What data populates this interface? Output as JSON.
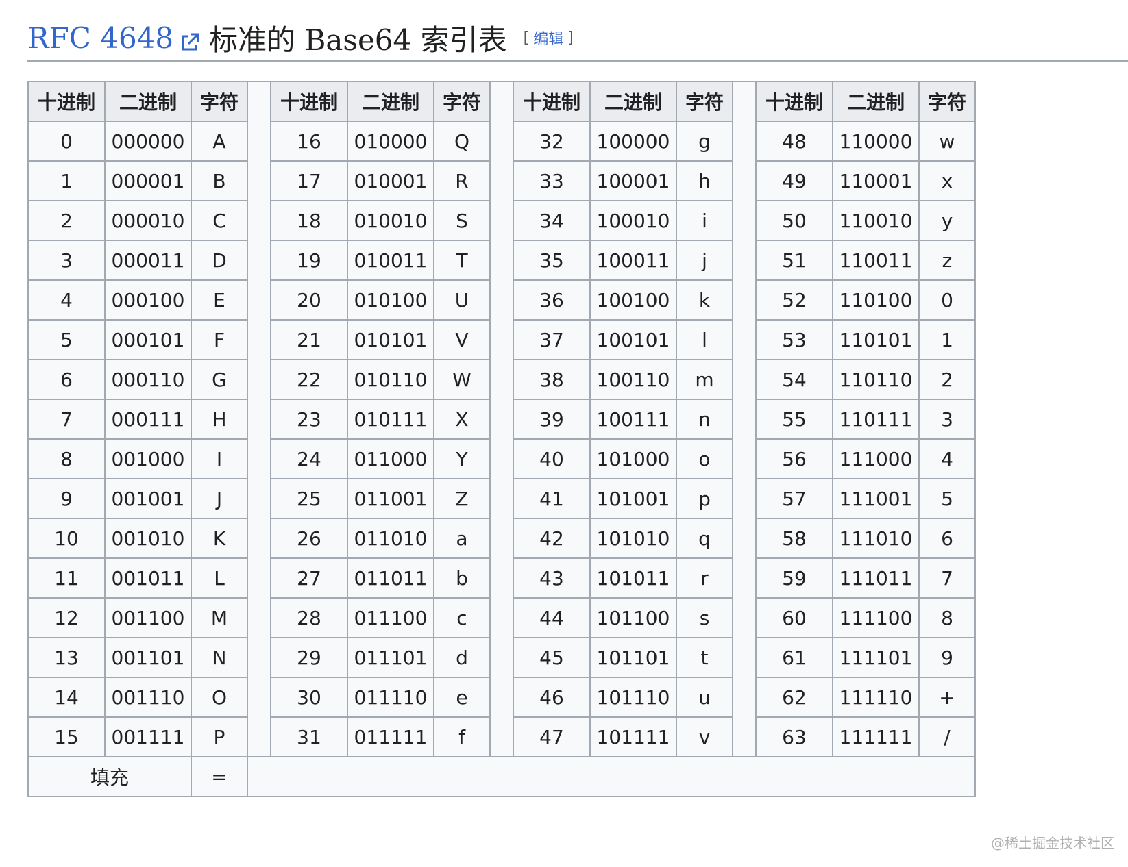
{
  "heading": {
    "rfc_link": "RFC 4648",
    "title_rest": "标准的 Base64 索引表",
    "edit_bracket_open": "[",
    "edit_label": "编辑",
    "edit_bracket_close": "]"
  },
  "table": {
    "headers": [
      "十进制",
      "二进制",
      "字符"
    ],
    "rows": [
      [
        [
          "0",
          "000000",
          "A"
        ],
        [
          "16",
          "010000",
          "Q"
        ],
        [
          "32",
          "100000",
          "g"
        ],
        [
          "48",
          "110000",
          "w"
        ]
      ],
      [
        [
          "1",
          "000001",
          "B"
        ],
        [
          "17",
          "010001",
          "R"
        ],
        [
          "33",
          "100001",
          "h"
        ],
        [
          "49",
          "110001",
          "x"
        ]
      ],
      [
        [
          "2",
          "000010",
          "C"
        ],
        [
          "18",
          "010010",
          "S"
        ],
        [
          "34",
          "100010",
          "i"
        ],
        [
          "50",
          "110010",
          "y"
        ]
      ],
      [
        [
          "3",
          "000011",
          "D"
        ],
        [
          "19",
          "010011",
          "T"
        ],
        [
          "35",
          "100011",
          "j"
        ],
        [
          "51",
          "110011",
          "z"
        ]
      ],
      [
        [
          "4",
          "000100",
          "E"
        ],
        [
          "20",
          "010100",
          "U"
        ],
        [
          "36",
          "100100",
          "k"
        ],
        [
          "52",
          "110100",
          "0"
        ]
      ],
      [
        [
          "5",
          "000101",
          "F"
        ],
        [
          "21",
          "010101",
          "V"
        ],
        [
          "37",
          "100101",
          "l"
        ],
        [
          "53",
          "110101",
          "1"
        ]
      ],
      [
        [
          "6",
          "000110",
          "G"
        ],
        [
          "22",
          "010110",
          "W"
        ],
        [
          "38",
          "100110",
          "m"
        ],
        [
          "54",
          "110110",
          "2"
        ]
      ],
      [
        [
          "7",
          "000111",
          "H"
        ],
        [
          "23",
          "010111",
          "X"
        ],
        [
          "39",
          "100111",
          "n"
        ],
        [
          "55",
          "110111",
          "3"
        ]
      ],
      [
        [
          "8",
          "001000",
          "I"
        ],
        [
          "24",
          "011000",
          "Y"
        ],
        [
          "40",
          "101000",
          "o"
        ],
        [
          "56",
          "111000",
          "4"
        ]
      ],
      [
        [
          "9",
          "001001",
          "J"
        ],
        [
          "25",
          "011001",
          "Z"
        ],
        [
          "41",
          "101001",
          "p"
        ],
        [
          "57",
          "111001",
          "5"
        ]
      ],
      [
        [
          "10",
          "001010",
          "K"
        ],
        [
          "26",
          "011010",
          "a"
        ],
        [
          "42",
          "101010",
          "q"
        ],
        [
          "58",
          "111010",
          "6"
        ]
      ],
      [
        [
          "11",
          "001011",
          "L"
        ],
        [
          "27",
          "011011",
          "b"
        ],
        [
          "43",
          "101011",
          "r"
        ],
        [
          "59",
          "111011",
          "7"
        ]
      ],
      [
        [
          "12",
          "001100",
          "M"
        ],
        [
          "28",
          "011100",
          "c"
        ],
        [
          "44",
          "101100",
          "s"
        ],
        [
          "60",
          "111100",
          "8"
        ]
      ],
      [
        [
          "13",
          "001101",
          "N"
        ],
        [
          "29",
          "011101",
          "d"
        ],
        [
          "45",
          "101101",
          "t"
        ],
        [
          "61",
          "111101",
          "9"
        ]
      ],
      [
        [
          "14",
          "001110",
          "O"
        ],
        [
          "30",
          "011110",
          "e"
        ],
        [
          "46",
          "101110",
          "u"
        ],
        [
          "62",
          "111110",
          "+"
        ]
      ],
      [
        [
          "15",
          "001111",
          "P"
        ],
        [
          "31",
          "011111",
          "f"
        ],
        [
          "47",
          "101111",
          "v"
        ],
        [
          "63",
          "111111",
          "/"
        ]
      ]
    ],
    "padding_label": "填充",
    "padding_char": "="
  },
  "watermark": "@稀土掘金技术社区",
  "colors": {
    "link": "#3366cc",
    "border": "#a2a9b1",
    "header_bg": "#eaecf0",
    "cell_bg": "#f8f9fa"
  },
  "icons": {
    "external_link": "external-link-icon"
  }
}
